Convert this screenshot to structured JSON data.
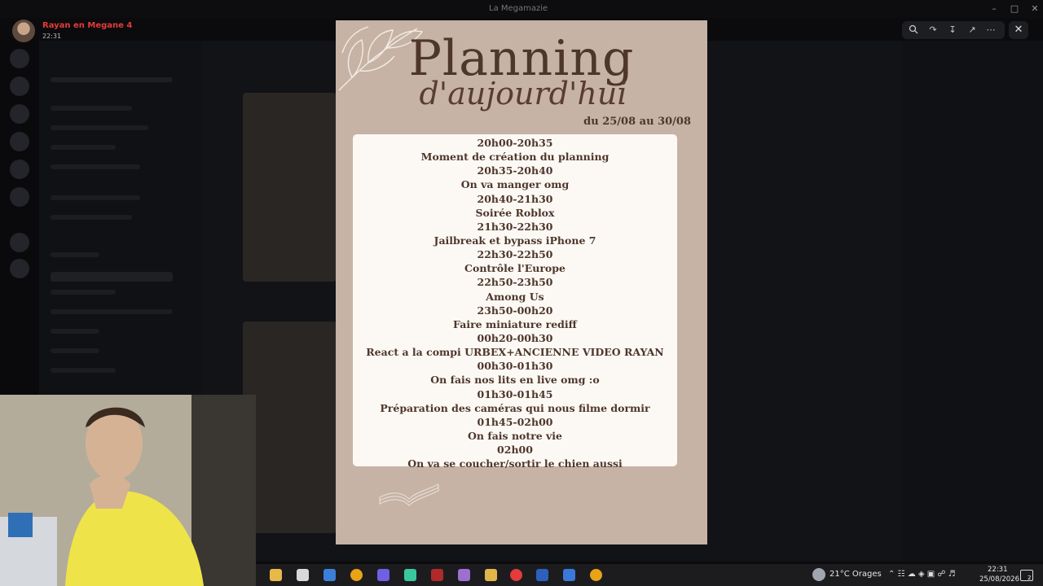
{
  "window": {
    "title": "La Megamazie"
  },
  "notification": {
    "title": "Rayan en Megane 4",
    "time": "22:31"
  },
  "overlay_toolbar": {
    "buttons": [
      "zoom-icon",
      "reply-icon",
      "download-icon",
      "open-external-icon",
      "more-icon"
    ],
    "close_icon": "close-icon"
  },
  "planning": {
    "title": "Planning",
    "subtitle": "d'aujourd'hui",
    "dates": "du 25/08 au 30/08",
    "entries": [
      {
        "time": "20h00-20h35",
        "activity": "Moment de création du planning"
      },
      {
        "time": "20h35-20h40",
        "activity": "On va manger omg"
      },
      {
        "time": "20h40-21h30",
        "activity": "Soirée Roblox"
      },
      {
        "time": "21h30-22h30",
        "activity": "Jailbreak et bypass iPhone 7"
      },
      {
        "time": "22h30-22h50",
        "activity": "Contrôle l'Europe"
      },
      {
        "time": "22h50-23h50",
        "activity": "Among Us"
      },
      {
        "time": "23h50-00h20",
        "activity": "Faire miniature rediff"
      },
      {
        "time": "00h20-00h30",
        "activity": "React a la compi URBEX+ANCIENNE VIDEO RAYAN"
      },
      {
        "time": "00h30-01h30",
        "activity": "On fais nos lits en live omg :o"
      },
      {
        "time": "01h30-01h45",
        "activity": "Préparation des caméras qui nous filme dormir"
      },
      {
        "time": "01h45-02h00",
        "activity": "On fais notre vie"
      },
      {
        "time": "02h00",
        "activity": "On va se coucher/sortir le chien aussi"
      }
    ]
  },
  "taskbar": {
    "weather": "21°C Orages",
    "time": "22:31",
    "date": "25/08/2026",
    "notification_count": "2",
    "apps": [
      "file-explorer-icon",
      "store-icon",
      "mail-icon",
      "chrome-icon",
      "discord-icon",
      "photos-icon",
      "terminal-icon",
      "game-icon",
      "crown-icon",
      "obs-icon",
      "word-icon",
      "css-icon",
      "chrome-icon"
    ],
    "colors": {
      "taskbar": "#1c1c1f",
      "accent": "#e43b3b"
    }
  }
}
